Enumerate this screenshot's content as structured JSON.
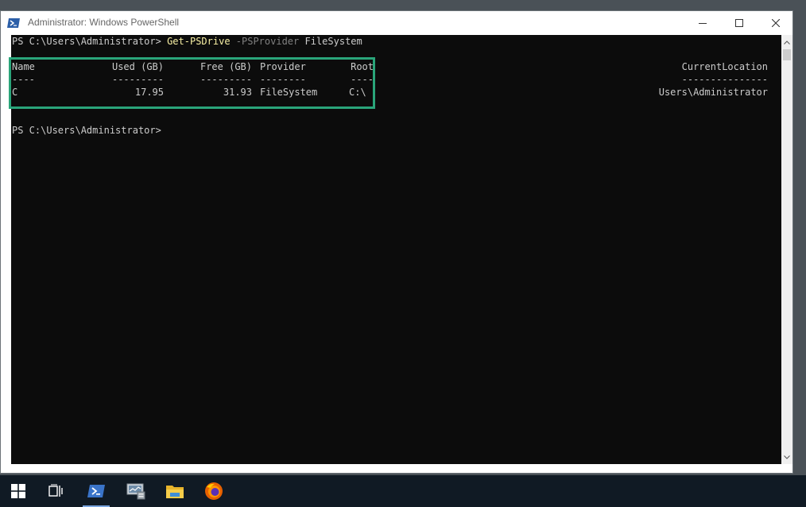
{
  "window": {
    "title": "Administrator: Windows PowerShell",
    "icon": "powershell-icon",
    "controls": [
      "minimize-icon",
      "maximize-icon",
      "close-icon"
    ]
  },
  "console": {
    "prompt1": "PS C:\\Users\\Administrator> ",
    "command": "Get-PSDrive",
    "param_name": " -PSProvider",
    "param_value": " FileSystem",
    "prompt2": "PS C:\\Users\\Administrator>",
    "table": {
      "headers": {
        "name": "Name",
        "used": "Used (GB)",
        "free": "Free (GB)",
        "provider": "Provider",
        "root": "Root",
        "current_location": "CurrentLocation"
      },
      "separators": {
        "name": "----",
        "used": "---------",
        "free": "---------",
        "provider": "--------",
        "root": "----",
        "current_location": "---------------"
      },
      "rows": [
        {
          "name": "C",
          "used": "17.95",
          "free": "31.93",
          "provider": "FileSystem",
          "root": "C:\\",
          "current_location": "Users\\Administrator"
        }
      ]
    }
  },
  "colors": {
    "console_bg": "#0c0c0c",
    "console_text": "#cccccc",
    "command": "#f9f1a5",
    "parameter": "#808080",
    "highlight_box": "#2aa57a",
    "taskbar": "#101a24"
  },
  "taskbar": {
    "items": [
      "start-icon",
      "task-view-icon",
      "powershell-icon",
      "server-manager-icon",
      "file-explorer-icon",
      "firefox-icon"
    ],
    "active": "powershell-icon"
  }
}
